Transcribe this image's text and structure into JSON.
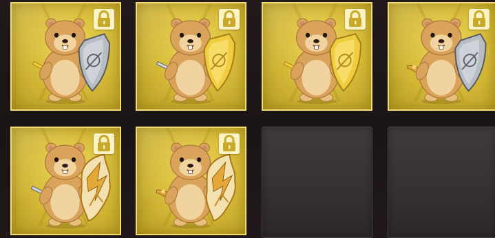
{
  "inventory": {
    "slots": [
      {
        "state": "filled",
        "locked": true,
        "character": "hamster",
        "weapon": "gold-sword",
        "shield": "silver-shield"
      },
      {
        "state": "filled",
        "locked": true,
        "character": "hamster",
        "weapon": "steel-sword",
        "shield": "gold-shield"
      },
      {
        "state": "filled",
        "locked": true,
        "character": "hamster",
        "weapon": "gold-sword",
        "shield": "gold-shield"
      },
      {
        "state": "filled",
        "locked": true,
        "character": "hamster",
        "weapon": "ornate-sword",
        "shield": "silver-shield"
      },
      {
        "state": "filled",
        "locked": true,
        "character": "hamster",
        "weapon": "steel-sword",
        "shield": "ornate-shield"
      },
      {
        "state": "filled",
        "locked": true,
        "character": "hamster",
        "weapon": "ornate-sword",
        "shield": "ornate-shield"
      },
      {
        "state": "empty"
      },
      {
        "state": "empty"
      }
    ]
  },
  "colors": {
    "slot_gold": "#d8bd3a",
    "slot_border": "#f3de76",
    "lock_badge": "#fbf3c6",
    "lock_glyph": "#c9a82a",
    "fur": "#d9a35c",
    "fur_light": "#f1d3a0",
    "empty_slot": "#343033"
  },
  "icons": {
    "lock": "lock-icon",
    "character": "hamster-warrior-icon"
  }
}
